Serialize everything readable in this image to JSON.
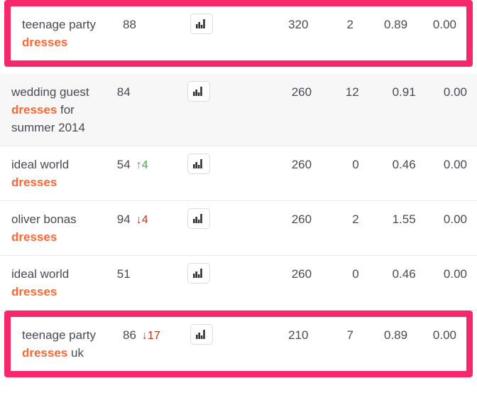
{
  "table": {
    "highlight_color": "#F8266A",
    "keyword_accent_color": "#FF6633",
    "up_color": "#3FAF46",
    "down_color": "#D0301B",
    "chart_icon": "bar-chart-icon",
    "rows": [
      {
        "keyword_prefix": "teenage party ",
        "keyword_accent": "dresses",
        "keyword_suffix": "",
        "position": "88",
        "delta": "",
        "delta_dir": "none",
        "volume": "320",
        "competition": "2",
        "cpc": "0.89",
        "last": "0.00",
        "highlighted": true,
        "alt": false
      },
      {
        "keyword_prefix": "wedding guest ",
        "keyword_accent": "dresses",
        "keyword_suffix": " for summer 2014",
        "position": "84",
        "delta": "",
        "delta_dir": "none",
        "volume": "260",
        "competition": "12",
        "cpc": "0.91",
        "last": "0.00",
        "highlighted": false,
        "alt": true
      },
      {
        "keyword_prefix": "ideal world ",
        "keyword_accent": "dresses",
        "keyword_suffix": "",
        "position": "54",
        "delta": "4",
        "delta_dir": "up",
        "volume": "260",
        "competition": "0",
        "cpc": "0.46",
        "last": "0.00",
        "highlighted": false,
        "alt": false
      },
      {
        "keyword_prefix": "oliver bonas ",
        "keyword_accent": "dresses",
        "keyword_suffix": "",
        "position": "94",
        "delta": "4",
        "delta_dir": "down",
        "volume": "260",
        "competition": "2",
        "cpc": "1.55",
        "last": "0.00",
        "highlighted": false,
        "alt": false
      },
      {
        "keyword_prefix": "ideal world ",
        "keyword_accent": "dresses",
        "keyword_suffix": "",
        "position": "51",
        "delta": "",
        "delta_dir": "none",
        "volume": "260",
        "competition": "0",
        "cpc": "0.46",
        "last": "0.00",
        "highlighted": false,
        "alt": false
      },
      {
        "keyword_prefix": "teenage party ",
        "keyword_accent": "dresses",
        "keyword_suffix": " uk",
        "position": "86",
        "delta": "17",
        "delta_dir": "down",
        "volume": "210",
        "competition": "7",
        "cpc": "0.89",
        "last": "0.00",
        "highlighted": true,
        "alt": false
      }
    ]
  }
}
